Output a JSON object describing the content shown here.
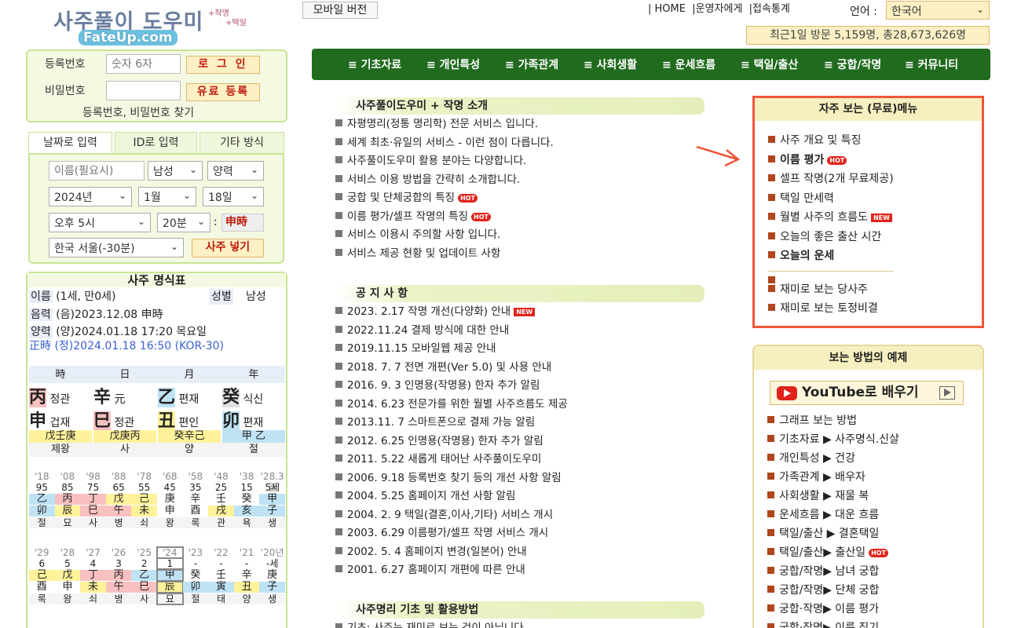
{
  "logo": {
    "main": "사주풀이 도우미",
    "sub1": "+작명",
    "sub2": "+택일",
    "site": "FateUp.com"
  },
  "login": {
    "reg_label": "등록번호",
    "reg_placeholder": "숫자 6자",
    "login_btn": "로 그 인",
    "pw_label": "비밀번호",
    "paid_btn": "유료 등록",
    "find_link": "등록번호, 비밀번호 찾기"
  },
  "tabs": [
    "날짜로 입력",
    "ID로 입력",
    "기타 방식"
  ],
  "form": {
    "name_placeholder": "이름(필요시)",
    "gender": "남성",
    "calendar": "양력",
    "year": "2024년",
    "month": "1월",
    "day": "18일",
    "hour": "오후 5시",
    "minute": "20분",
    "shi": "申時",
    "region": "한국 서울(-30분)",
    "submit": "사주 넣기"
  },
  "saju": {
    "title": "사주 명식표",
    "name_lbl": "이름",
    "name_val": "(1세, 만0세)",
    "sex_lbl": "성별",
    "sex_val": "남성",
    "lunar_lbl": "음력",
    "lunar_val": "(음)2023.12.08 申時",
    "solar_lbl": "양력",
    "solar_val": "(양)2024.01.18 17:20 목요일",
    "true_time": "正時 (정)2024.01.18 16:50 (KOR-30)",
    "pillars_head": [
      "時",
      "日",
      "月",
      "年"
    ],
    "stems": [
      {
        "c": "丙",
        "t": "정관"
      },
      {
        "c": "辛",
        "t": "元"
      },
      {
        "c": "乙",
        "t": "편재"
      },
      {
        "c": "癸",
        "t": "식신"
      }
    ],
    "branches": [
      {
        "c": "申",
        "t": "겁재"
      },
      {
        "c": "巳",
        "t": "정관"
      },
      {
        "c": "丑",
        "t": "편인"
      },
      {
        "c": "卯",
        "t": "편재"
      }
    ],
    "hidden": [
      "戊壬庚",
      "戊庚丙",
      "癸辛己",
      "甲 乙"
    ],
    "stage": [
      "제왕",
      "사",
      "양",
      "절"
    ],
    "dy_years": [
      "'18",
      "'08",
      "'98",
      "'88",
      "'78",
      "'68",
      "'58",
      "'48",
      "'38",
      "'28.3월"
    ],
    "dy_ages": [
      "95",
      "85",
      "75",
      "65",
      "55",
      "45",
      "35",
      "25",
      "15",
      "5세"
    ],
    "dy_stems": [
      "乙",
      "丙",
      "丁",
      "戊",
      "己",
      "庚",
      "辛",
      "壬",
      "癸",
      "甲"
    ],
    "dy_branches": [
      "卯",
      "辰",
      "巳",
      "午",
      "未",
      "申",
      "酉",
      "戌",
      "亥",
      "子"
    ],
    "dy_stage": [
      "절",
      "묘",
      "사",
      "병",
      "쇠",
      "왕",
      "록",
      "관",
      "욕",
      "생"
    ],
    "sy_years": [
      "'29",
      "'28",
      "'27",
      "'26",
      "'25",
      "'24",
      "'23",
      "'22",
      "'21",
      "'20년"
    ],
    "sy_ages": [
      "6",
      "5",
      "4",
      "3",
      "2",
      "1",
      "-",
      "-",
      "-",
      "-세"
    ],
    "sy_stems": [
      "己",
      "戊",
      "丁",
      "丙",
      "乙",
      "甲",
      "癸",
      "壬",
      "辛",
      "庚"
    ],
    "sy_branches": [
      "酉",
      "申",
      "未",
      "午",
      "巳",
      "辰",
      "卯",
      "寅",
      "丑",
      "子"
    ],
    "sy_stage": [
      "록",
      "왕",
      "쇠",
      "병",
      "사",
      "묘",
      "절",
      "태",
      "양",
      "생"
    ]
  },
  "top": {
    "mobile": "모바일 버전",
    "home": "| HOME",
    "admin": "|운영자에게",
    "stats": "|접속통계",
    "lang_lbl": "언어 :",
    "lang": "한국어",
    "visits": "최근1일 방문 5,159명, 총28,673,626명"
  },
  "nav": [
    "≡ 기초자료",
    "≡ 개인특성",
    "≡ 가족관계",
    "≡ 사회생활",
    "≡ 운세흐름",
    "≡ 택일/출산",
    "≡ 궁합/작명",
    "≡ 커뮤니티"
  ],
  "intro": {
    "title": "사주풀이도우미 + 작명 소개",
    "items": [
      "자평명리(정통 명리학) 전문 서비스 입니다.",
      "세계 최초·유일의 서비스 - 이런 점이 다릅니다.",
      "사주풀이도우미 활용 분야는 다양합니다.",
      "서비스 이용 방법을 간략히 소개합니다.",
      "궁합 및 단체궁합의 특징",
      "이름 평가/셀프 작명의 특징",
      "서비스 이용시 주의할 사항 입니다.",
      "서비스 제공 현황 및 업데이트 사항"
    ]
  },
  "notice": {
    "title": "공 지 사 항",
    "items": [
      "2023. 2.17 작명 개선(다양화) 안내",
      "2022.11.24 결제 방식에 대한 안내",
      "2019.11.15 모바일웹 제공 안내",
      "2018. 7. 7 전면 개편(Ver 5.0) 및 사용 안내",
      "2016. 9. 3 인명용(작명용) 한자 추가 알림",
      "2014. 6.23 전문가를 위한 월별 사주흐름도 제공",
      "2013.11. 7 스마트폰으로 결제 가능 알림",
      "2012. 6.25 인명용(작명용) 한자 추가 알림",
      "2011. 5.22 새롭게 태어난 사주풀이도우미",
      "2006. 9.18 등록번호 찾기 등의 개선 사항 알림",
      "2004. 5.25 홈페이지 개선 사항 알림",
      "2004. 2. 9 택일(결혼,이사,기타) 서비스 개시",
      "2003. 6.29 이름평가/셀프 작명 서비스 개시",
      "2002. 5. 4 홈페이지 변경(일본어) 안내",
      "2001. 6.27 홈페이지 개편에 따른 안내"
    ]
  },
  "basics": {
    "title": "사주명리 기초 및 활용방법",
    "item": "기초: 사주는 재미로 보는 것이 아닙니다"
  },
  "badges": {
    "hot": "HOT",
    "new": "NEW"
  },
  "fav": {
    "title": "자주 보는 (무료)메뉴",
    "items": [
      "사주 개요 및 특징",
      "이름 평가",
      "셀프 작명(2개 무료제공)",
      "택일 만세력",
      "월별 사주의 흐름도",
      "오늘의 좋은 출산 시간",
      "오늘의 운세",
      "재미로 보는 당사주",
      "재미로 보는 토정비결"
    ]
  },
  "examples": {
    "title": "보는 방법의 예제",
    "youtube": "YouTube로  배우기",
    "items": [
      "그래프 보는 방법",
      "기초자료 ▶ 사주명식.신살",
      "개인특성 ▶ 건강",
      "가족관계 ▶ 배우자",
      "사회생활 ▶ 재물 복",
      "운세흐름 ▶ 대운 흐름",
      "택일/출산 ▶ 결혼택일",
      "택일/출산▶ 출산일",
      "궁합/작명▶ 남녀 궁합",
      "궁합/작명▶ 단체 궁합",
      "궁합·작명▶ 이름 평가",
      "궁합·작명▶ 이름 짓기"
    ]
  },
  "colors": {
    "accent": "#f2553b",
    "nav": "#216b1e",
    "border": "#c8e494"
  }
}
